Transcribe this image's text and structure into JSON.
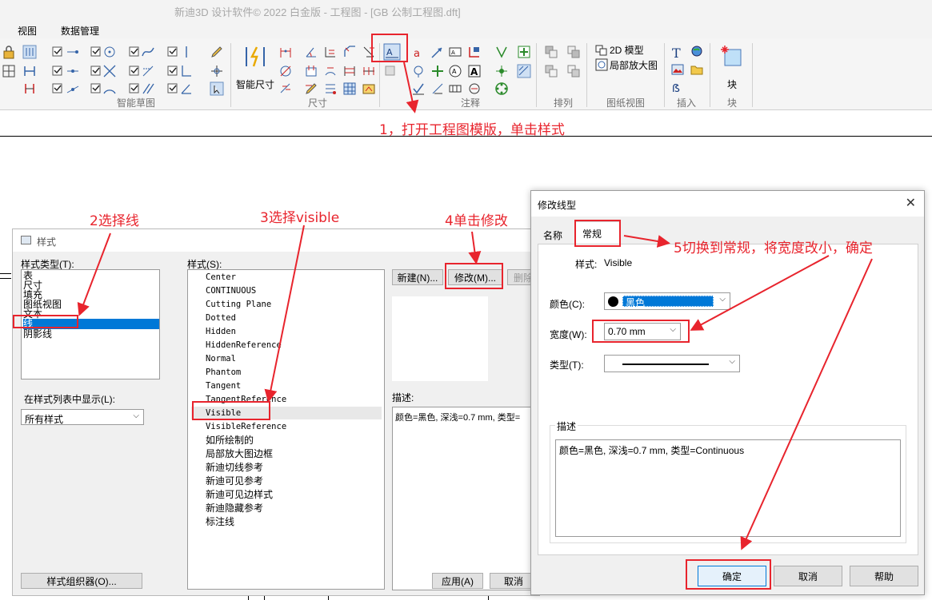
{
  "window": {
    "title": "新迪3D 设计软件© 2022 白金版 - 工程图 - [GB 公制工程图.dft]"
  },
  "menu": {
    "items": [
      "视图",
      "数据管理"
    ]
  },
  "ribbon": {
    "groups": [
      "智能草图",
      "尺寸",
      "注释",
      "排列",
      "图纸视图",
      "插入"
    ],
    "smart_dim_label": "智能尺寸",
    "model_2d_label": "2D 模型",
    "detail_view_label": "局部放大图",
    "block_label": "块",
    "block_group": "块"
  },
  "annotations": {
    "step1": "1，打开工程图模版，单击样式",
    "step2": "2选择线",
    "step3": "3选择visible",
    "step4": "4单击修改",
    "step5": "5切换到常规，将宽度改小，确定"
  },
  "style_dialog": {
    "title": "样式",
    "type_label": "样式类型(T):",
    "types": [
      "表",
      "尺寸",
      "填充",
      "图纸视图",
      "文本",
      "线",
      "阴影线"
    ],
    "selected_type": "线",
    "styles_label": "样式(S):",
    "styles": [
      "Center",
      "CONTINUOUS",
      "Cutting Plane",
      "Dotted",
      "Hidden",
      "HiddenReference",
      "Normal",
      "Phantom",
      "Tangent",
      "TangentReference",
      "Visible",
      "VisibleReference",
      "如所绘制的",
      "局部放大图边框",
      "新迪切线参考",
      "新迪可见参考",
      "新迪可见边样式",
      "新迪隐藏参考",
      "标注线"
    ],
    "selected_style": "Visible",
    "show_label": "在样式列表中显示(L):",
    "show_value": "所有样式",
    "new_button": "新建(N)...",
    "modify_button": "修改(M)...",
    "delete_button": "删除",
    "desc_label": "描述:",
    "desc_text": "颜色=黑色, 深浅=0.7 mm, 类型=",
    "organizer_button": "样式组织器(O)...",
    "apply_button": "应用(A)",
    "cancel_button": "取消"
  },
  "modify_dialog": {
    "title": "修改线型",
    "close": "✕",
    "tabs": [
      "名称",
      "常规"
    ],
    "active_tab": "常规",
    "style_label": "样式:",
    "style_value": "Visible",
    "color_label": "颜色(C):",
    "color_value": "黑色",
    "width_label": "宽度(W):",
    "width_value": "0.70 mm",
    "type_label": "类型(T):",
    "desc_group": "描述",
    "desc_text": "颜色=黑色, 深浅=0.7 mm, 类型=Continuous",
    "ok_button": "确定",
    "cancel_button": "取消",
    "help_button": "帮助"
  },
  "colors": {
    "accent": "#e8242d",
    "selection": "#0078d7"
  }
}
